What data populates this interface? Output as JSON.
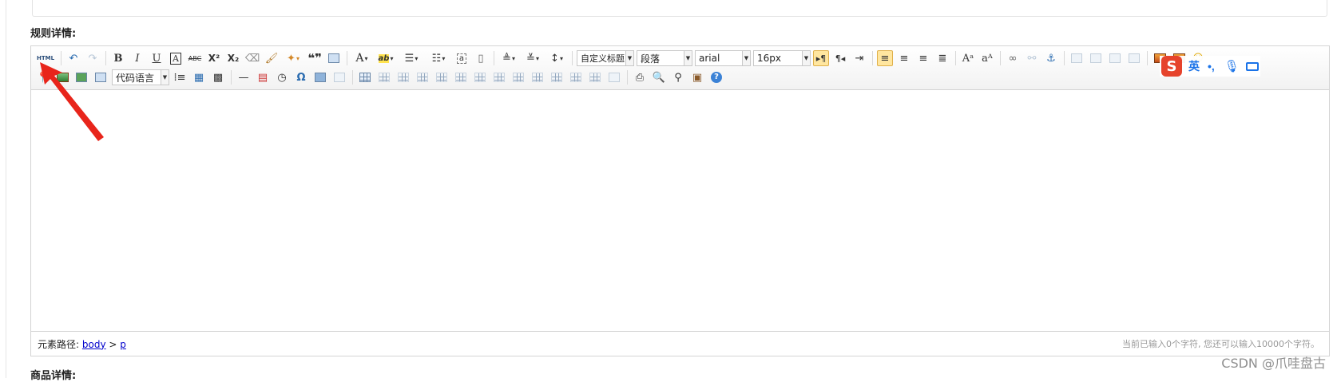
{
  "sections": {
    "rules_label": "规则详情:",
    "goods_label": "商品详情:"
  },
  "toolbar": {
    "html_button": "HTML",
    "bold": "B",
    "italic": "I",
    "underline": "U",
    "font_border": "A",
    "strikethrough": "ABC",
    "superscript": "X²",
    "subscript": "X₂",
    "quote": "❝❞",
    "font_color": "A",
    "bg_color": "ab",
    "para_format": "自定义标题",
    "paragraph": "段落",
    "font_family": "arial",
    "font_size": "16px",
    "code_language": "代码语言",
    "omega": "Ω"
  },
  "status_bar": {
    "path_label": "元素路径:",
    "path_body": "body",
    "path_sep": ">",
    "path_p": "p",
    "char_count": "当前已输入0个字符, 您还可以输入10000个字符。"
  },
  "ime": {
    "logo": "S",
    "mode": "英",
    "punct": "•,"
  },
  "watermark": "CSDN @爪哇盘古",
  "colors": {
    "accent": "#ffe69f",
    "link": "#0000cc",
    "arrow": "#e8251b",
    "ime_blue": "#1a73e8",
    "ime_logo": "#e6432c"
  }
}
